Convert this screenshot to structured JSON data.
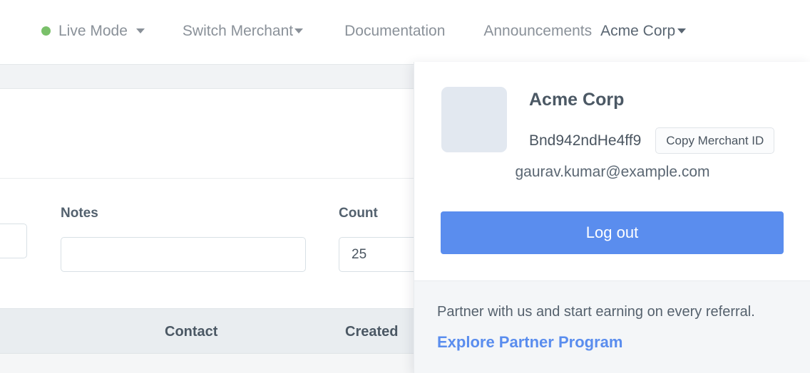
{
  "topnav": {
    "live_mode": {
      "label": "Live Mode",
      "status_color": "#7ac06a",
      "has_caret": true
    },
    "switch_merchant": {
      "label": "Switch Merchant",
      "has_caret": true
    },
    "documentation": {
      "label": "Documentation"
    },
    "announcements": {
      "label": "Announcements"
    },
    "account": {
      "label": "Acme Corp",
      "has_caret": true
    }
  },
  "background_page": {
    "filters": [
      {
        "label": "",
        "value": ""
      },
      {
        "label": "Notes",
        "value": ""
      },
      {
        "label": "Count",
        "value": "25"
      }
    ],
    "table": {
      "columns": [
        {
          "label": "Contact"
        },
        {
          "label": "Created"
        }
      ]
    }
  },
  "account_panel": {
    "merchant_name": "Acme Corp",
    "merchant_id": "Bnd942ndHe4ff9",
    "copy_button_label": "Copy Merchant ID",
    "email": "gaurav.kumar@example.com",
    "logout_label": "Log out",
    "footer": {
      "text": "Partner with us and start earning on every referral.",
      "link_label": "Explore Partner Program",
      "link_color": "#5a8dee"
    }
  },
  "theme": {
    "accent_blue": "#5a8dee",
    "status_green": "#7ac06a",
    "text_muted": "#8a9199",
    "text_dark": "#4b5864",
    "panel_footer_bg": "#f4f6f8",
    "table_header_bg": "#e9edf0"
  }
}
